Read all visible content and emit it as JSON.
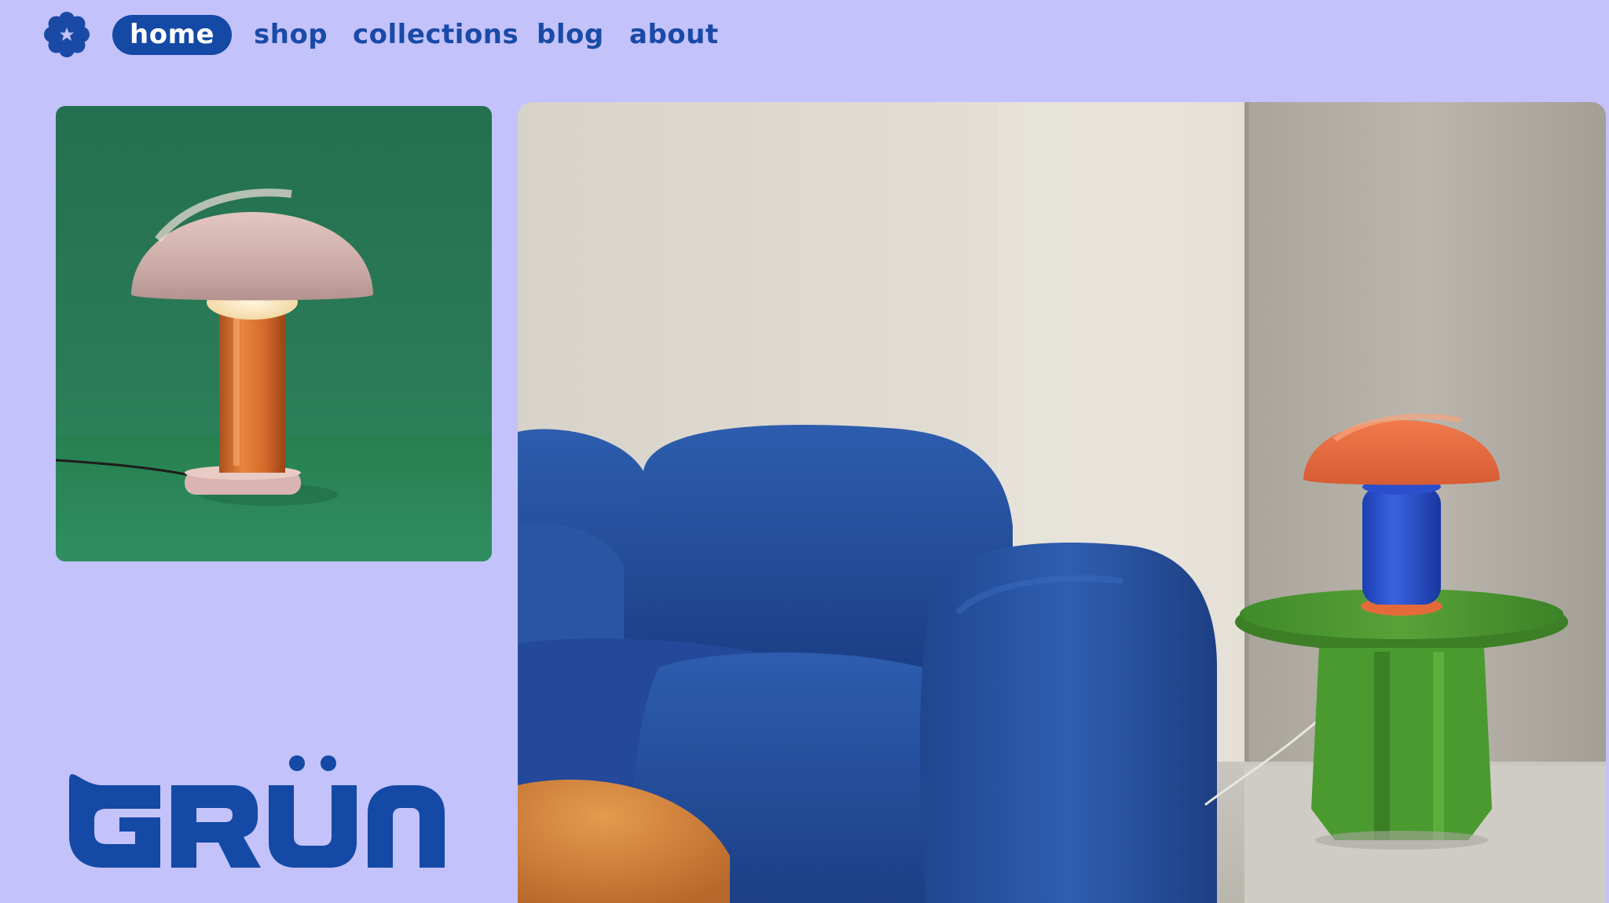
{
  "nav": {
    "logo_icon": "flower-badge-icon",
    "items": [
      {
        "label": "home",
        "active": true
      },
      {
        "label": "shop",
        "active": false
      },
      {
        "label": "collections",
        "active": false
      },
      {
        "label": "blog",
        "active": false
      },
      {
        "label": "about",
        "active": false
      }
    ]
  },
  "brand": {
    "wordmark": "GRÜN"
  },
  "product_tile": {
    "image": "mushroom-table-lamp-on-green"
  },
  "hero": {
    "image": "blue-boucle-sofa-with-lamp-on-green-side-table"
  },
  "colors": {
    "background": "#c3c2fb",
    "accent": "#1449a5",
    "nav_text": "#1a4aa6",
    "tile_green": "#2a7a57"
  }
}
